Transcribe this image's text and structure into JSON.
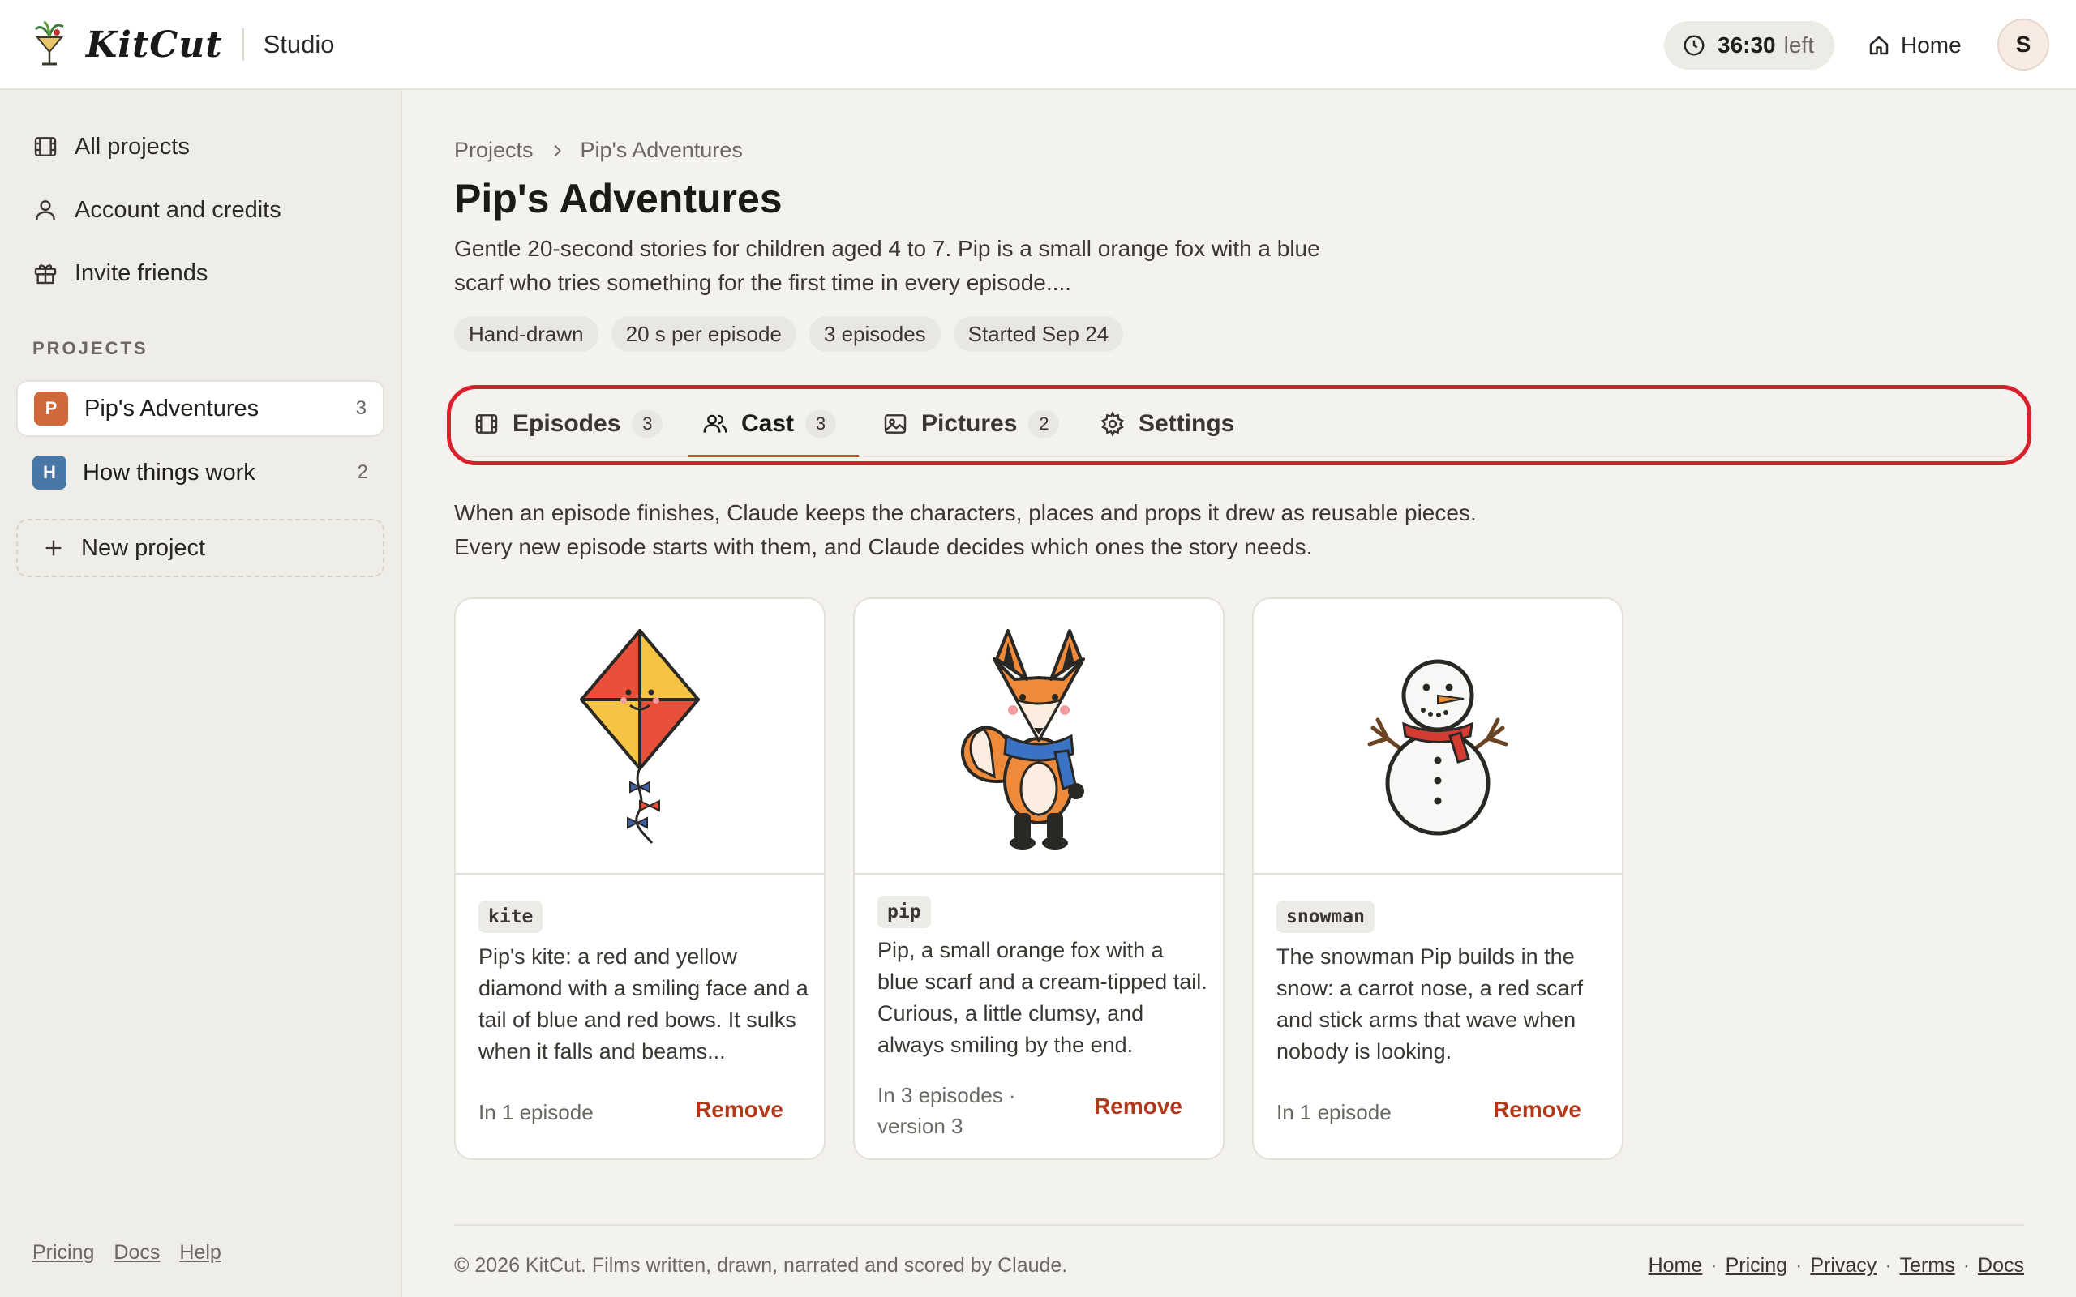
{
  "brand": {
    "name": "KitCut",
    "section": "Studio"
  },
  "header": {
    "timer_value": "36:30",
    "timer_suffix": "left",
    "home_label": "Home",
    "avatar_initial": "S"
  },
  "sidebar": {
    "nav": [
      {
        "label": "All projects",
        "icon": "film-icon"
      },
      {
        "label": "Account and credits",
        "icon": "user-icon"
      },
      {
        "label": "Invite friends",
        "icon": "gift-icon"
      }
    ],
    "section_label": "PROJECTS",
    "projects": [
      {
        "initial": "P",
        "name": "Pip's Adventures",
        "count": "3",
        "color": "#d0683a"
      },
      {
        "initial": "H",
        "name": "How things work",
        "count": "2",
        "color": "#4a78a6"
      }
    ],
    "new_project": "New project",
    "footer_links": [
      "Pricing",
      "Docs",
      "Help"
    ]
  },
  "breadcrumb": [
    "Projects",
    "Pip's Adventures"
  ],
  "page": {
    "title": "Pip's Adventures",
    "description": "Gentle 20-second stories for children aged 4 to 7. Pip is a small orange fox with a blue scarf who tries something for the first time in every episode....",
    "chips": [
      "Hand-drawn",
      "20 s per episode",
      "3 episodes",
      "Started Sep 24"
    ]
  },
  "tabs": [
    {
      "label": "Episodes",
      "count": "3",
      "icon": "film-icon"
    },
    {
      "label": "Cast",
      "count": "3",
      "icon": "users-icon",
      "active": true
    },
    {
      "label": "Pictures",
      "count": "2",
      "icon": "image-icon"
    },
    {
      "label": "Settings",
      "count": "",
      "icon": "gear-icon"
    }
  ],
  "cast": {
    "intro": "When an episode finishes, Claude keeps the characters, places and props it drew as reusable pieces. Every new episode starts with them, and Claude decides which ones the story needs.",
    "remove_label": "Remove",
    "items": [
      {
        "tag": "kite",
        "description": "Pip's kite: a red and yellow diamond with a smiling face and a tail of blue and red bows. It sulks when it falls and beams...",
        "meta": "In 1 episode"
      },
      {
        "tag": "pip",
        "description": "Pip, a small orange fox with a blue scarf and a cream-tipped tail. Curious, a little clumsy, and always smiling by the end.",
        "meta": "In 3 episodes · version 3"
      },
      {
        "tag": "snowman",
        "description": "The snowman Pip builds in the snow: a carrot nose, a red scarf and stick arms that wave when nobody is looking.",
        "meta": "In 1 episode"
      }
    ]
  },
  "footer": {
    "copyright": "© 2026 KitCut. Films written, drawn, narrated and scored by Claude.",
    "links": [
      "Home",
      "Pricing",
      "Privacy",
      "Terms",
      "Docs"
    ],
    "separator": "·"
  }
}
